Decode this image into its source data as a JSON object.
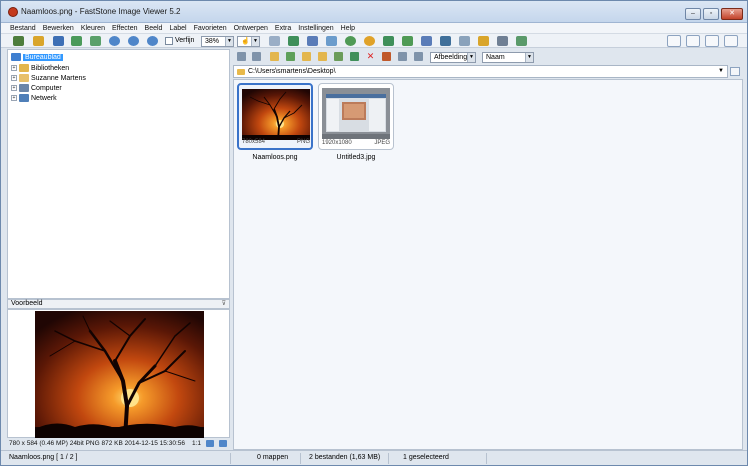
{
  "window": {
    "title": "Naamloos.png  -  FastStone Image Viewer 5.2",
    "controls": [
      "–",
      "▫",
      "✕"
    ]
  },
  "menu": [
    "Bestand",
    "Bewerken",
    "Kleuren",
    "Effecten",
    "Beeld",
    "Label",
    "Favorieten",
    "Ontwerpen",
    "Extra",
    "Instellingen",
    "Help"
  ],
  "toolbar": {
    "smooth_label": "Verfijn",
    "zoom_value": "38%",
    "hand_value": "☝"
  },
  "tree": [
    {
      "label": "Bureaublad",
      "selected": true,
      "icon": "desktop-icon",
      "expander": ""
    },
    {
      "label": "Bibliotheken",
      "selected": false,
      "icon": "library-icon",
      "expander": "+"
    },
    {
      "label": "Suzanne Martens",
      "selected": false,
      "icon": "user-folder-icon",
      "expander": "+"
    },
    {
      "label": "Computer",
      "selected": false,
      "icon": "computer-icon",
      "expander": "+"
    },
    {
      "label": "Netwerk",
      "selected": false,
      "icon": "network-icon",
      "expander": "+"
    }
  ],
  "preview": {
    "header": "Voorbeeld",
    "pin": "⊽",
    "info": "780 x 584 (0.46 MP)  24bit  PNG   872 KB   2014-12-15 15:30:56",
    "ratio": "1:1"
  },
  "browser": {
    "path": "C:\\Users\\smartens\\Desktop\\",
    "sort_filter": "Afbeelding",
    "sort_by": "Naam",
    "files": [
      {
        "name": "Naamloos.png",
        "dims": "780x584",
        "format": "PNG",
        "selected": true
      },
      {
        "name": "Untitled3.jpg",
        "dims": "1920x1080",
        "format": "JPEG",
        "selected": false
      }
    ]
  },
  "status": {
    "file": "Naamloos.png [ 1 / 2 ]",
    "folders": "0 mappen",
    "files": "2 bestanden (1,63 MB)",
    "selected": "1 geselecteerd"
  },
  "colors": {
    "selection": "#3399ff",
    "thumb_selected_border": "#3a73c9",
    "window_bg": "#dfe6ee"
  }
}
